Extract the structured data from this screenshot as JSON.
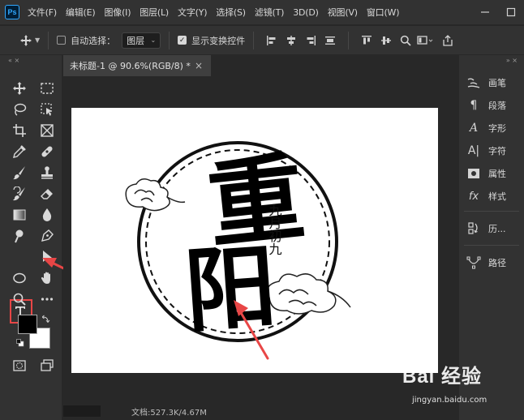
{
  "app": {
    "logo_text": "Ps"
  },
  "menu": [
    "文件(F)",
    "编辑(E)",
    "图像(I)",
    "图层(L)",
    "文字(Y)",
    "选择(S)",
    "滤镜(T)",
    "3D(D)",
    "视图(V)",
    "窗口(W)"
  ],
  "options": {
    "auto_select_label": "自动选择：",
    "auto_select_checked": false,
    "target_select": "图层",
    "show_transform_label": "显示变换控件",
    "show_transform_checked": true
  },
  "document": {
    "tab_title": "未标题-1 @ 90.6%(RGB/8) *",
    "close_glyph": "×",
    "status_text": "文档:527.3K/4.67M"
  },
  "artwork": {
    "big_chars": [
      "重",
      "阳"
    ],
    "vertical_text": "九月初九"
  },
  "right_panel": {
    "items": [
      {
        "icon": "brush-icon",
        "label": "画笔"
      },
      {
        "icon": "paragraph-icon",
        "label": "段落"
      },
      {
        "icon": "character-style-icon",
        "label": "字形"
      },
      {
        "icon": "character-icon",
        "label": "字符"
      },
      {
        "icon": "properties-icon",
        "label": "属性"
      },
      {
        "icon": "styles-icon",
        "label": "样式"
      },
      {
        "icon": "history-icon",
        "label": "历..."
      },
      {
        "icon": "paths-icon",
        "label": "路径"
      }
    ]
  },
  "watermark": {
    "main": "Bai 经验",
    "sub": "jingyan.baidu.com"
  },
  "colors": {
    "highlight": "#e84646",
    "arrow": "#e84646",
    "foreground": "#000000",
    "background": "#ffffff"
  }
}
